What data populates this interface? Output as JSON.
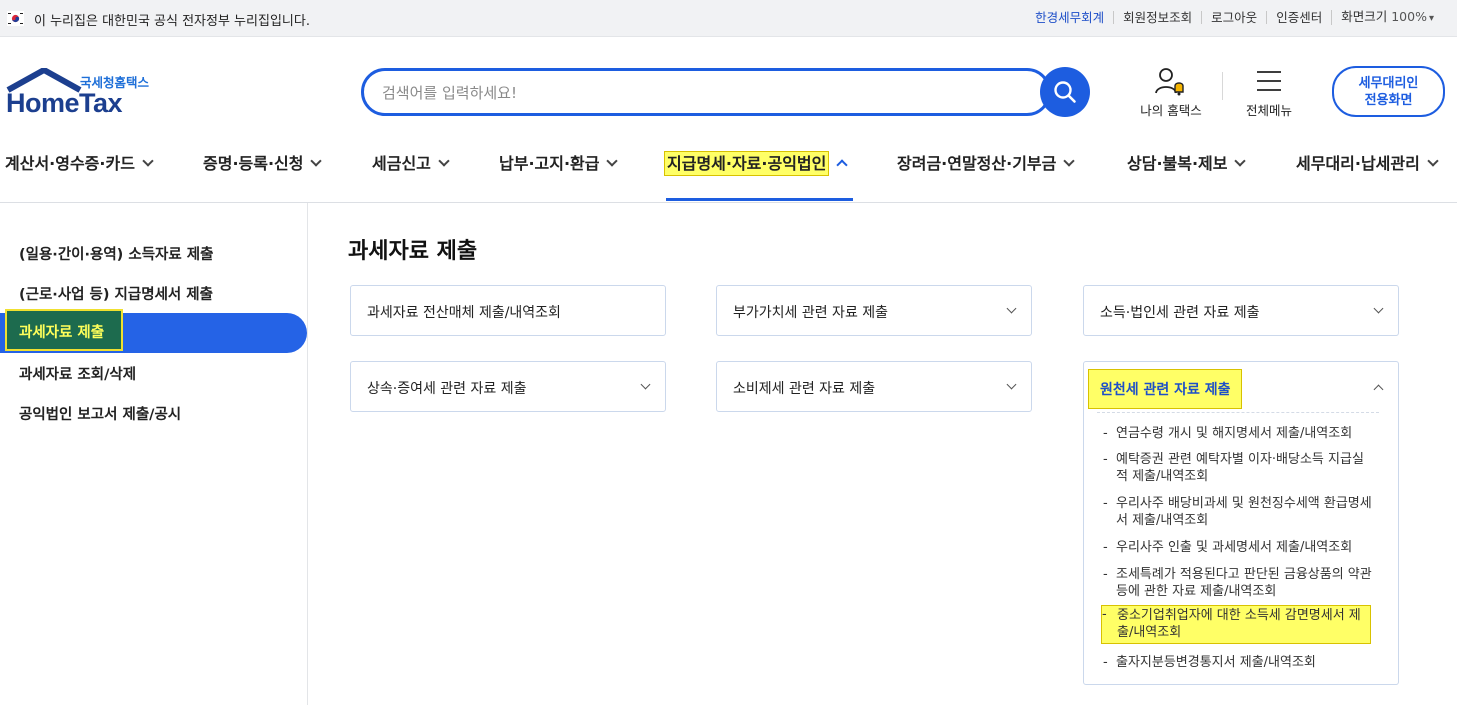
{
  "gov_banner": {
    "text": "이 누리집은 대한민국 공식 전자정부 누리집입니다."
  },
  "util_links": [
    "한경세무회계",
    "회원정보조회",
    "로그아웃",
    "인증센터",
    "화면크기"
  ],
  "zoom": "100%",
  "logo": {
    "sub": "국세청홈택스",
    "main": "HomeTax"
  },
  "search": {
    "placeholder": "검색어를 입력하세요!"
  },
  "header_icons": {
    "my": "나의 홈택스",
    "menu": "전체메뉴",
    "agent_line1": "세무대리인",
    "agent_line2": "전용화면"
  },
  "gnb": [
    "계산서·영수증·카드",
    "증명·등록·신청",
    "세금신고",
    "납부·고지·환급",
    "지급명세·자료·공익법인",
    "장려금·연말정산·기부금",
    "상담·불복·제보",
    "세무대리·납세관리"
  ],
  "side": [
    "(일용·간이·용역) 소득자료 제출",
    "(근로·사업 등) 지급명세서 제출",
    "과세자료 제출",
    "과세자료 조회/삭제",
    "공익법인 보고서 제출/공시"
  ],
  "page_title": "과세자료 제출",
  "cards": [
    "과세자료 전산매체 제출/내역조회",
    "부가가치세 관련 자료 제출",
    "소득·법인세 관련 자료 제출",
    "상속·증여세 관련 자료 제출",
    "소비제세 관련 자료 제출",
    "원천세 관련 자료 제출"
  ],
  "sub_items": [
    "연금수령 개시 및 해지명세서 제출/내역조회",
    "예탁증권 관련 예탁자별 이자·배당소득 지급실적 제출/내역조회",
    "우리사주 배당비과세 및 원천징수세액 환급명세서 제출/내역조회",
    "우리사주 인출 및 과세명세서 제출/내역조회",
    "조세특례가 적용된다고 판단된 금융상품의 약관 등에 관한 자료 제출/내역조회",
    "중소기업취업자에 대한 소득세 감면명세서 제출/내역조회",
    "출자지분등변경통지서 제출/내역조회"
  ],
  "colors": {
    "accent": "#1d5de0",
    "highlight": "#ffff66",
    "active_side": "#2563e6"
  }
}
